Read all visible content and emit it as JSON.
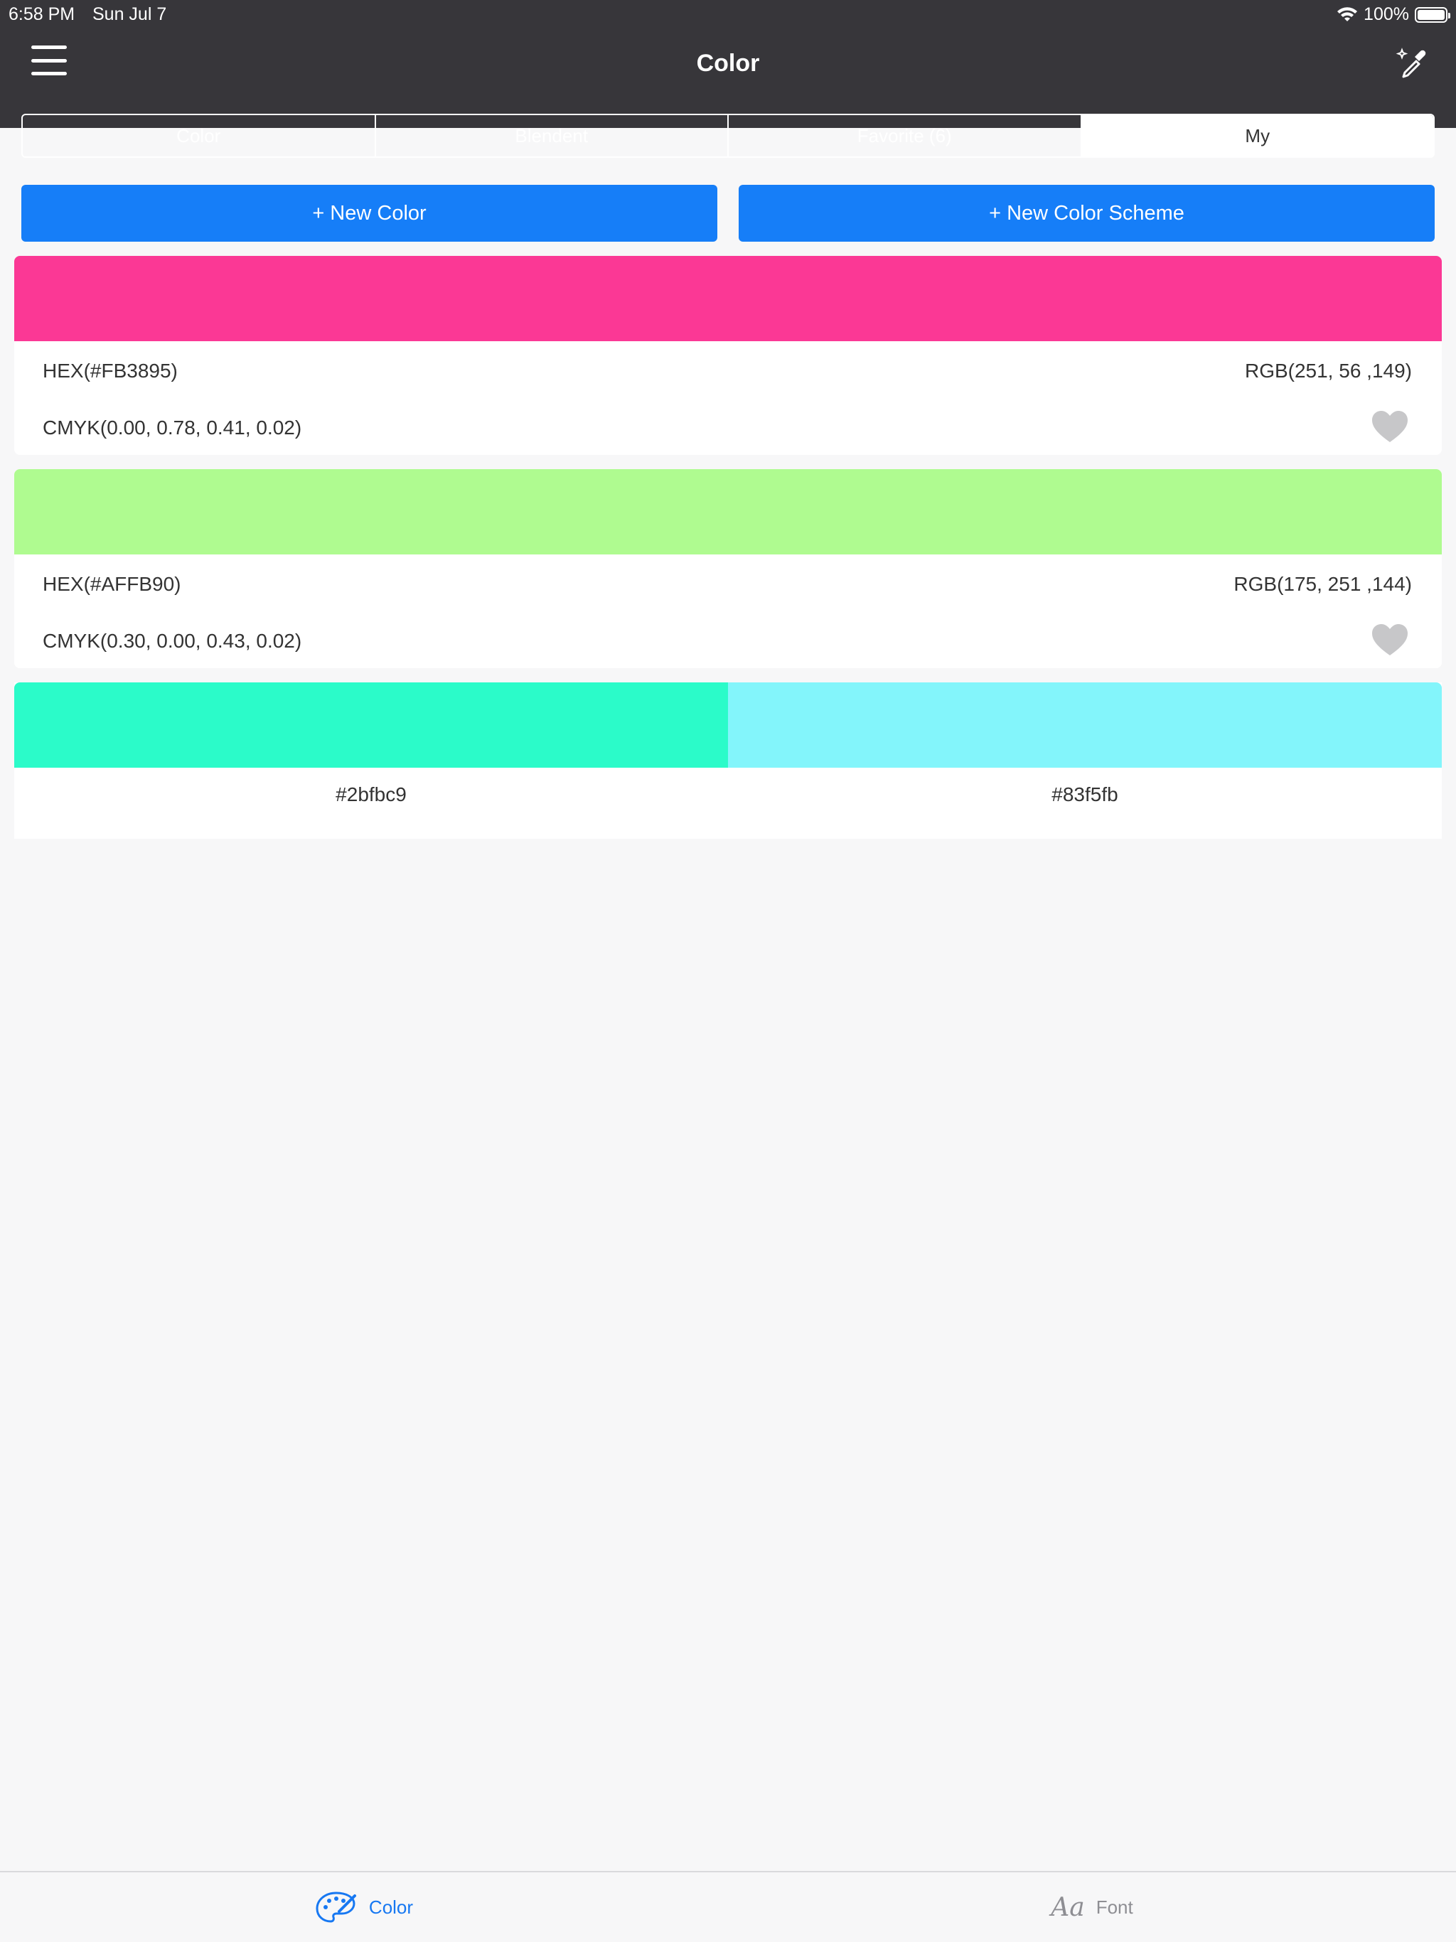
{
  "status": {
    "time": "6:58 PM",
    "date": "Sun Jul 7",
    "battery": "100%"
  },
  "nav": {
    "title": "Color"
  },
  "segments": [
    {
      "label": "Color"
    },
    {
      "label": "Blendent"
    },
    {
      "label": "Favorite (6)"
    },
    {
      "label": "My"
    }
  ],
  "actions": {
    "new_color": "+ New Color",
    "new_scheme": "+ New Color Scheme"
  },
  "colors": [
    {
      "swatch": "#FB3895",
      "hex": "HEX(#FB3895)",
      "rgb": "RGB(251, 56 ,149)",
      "cmyk": "CMYK(0.00, 0.78, 0.41, 0.02)"
    },
    {
      "swatch": "#AFFB90",
      "hex": "HEX(#AFFB90)",
      "rgb": "RGB(175, 251 ,144)",
      "cmyk": "CMYK(0.30, 0.00, 0.43, 0.02)"
    }
  ],
  "scheme": [
    {
      "swatch": "#2bfbc9",
      "label": "#2bfbc9"
    },
    {
      "swatch": "#83f5fb",
      "label": "#83f5fb"
    }
  ],
  "tabbar": {
    "color_label": "Color",
    "font_label": "Font",
    "font_icon_text": "Aa"
  },
  "theme": {
    "nav_bg": "#37363a",
    "accent": "#167ef8",
    "tab_active": "#1778f2",
    "heart": "#c7c7c9"
  }
}
